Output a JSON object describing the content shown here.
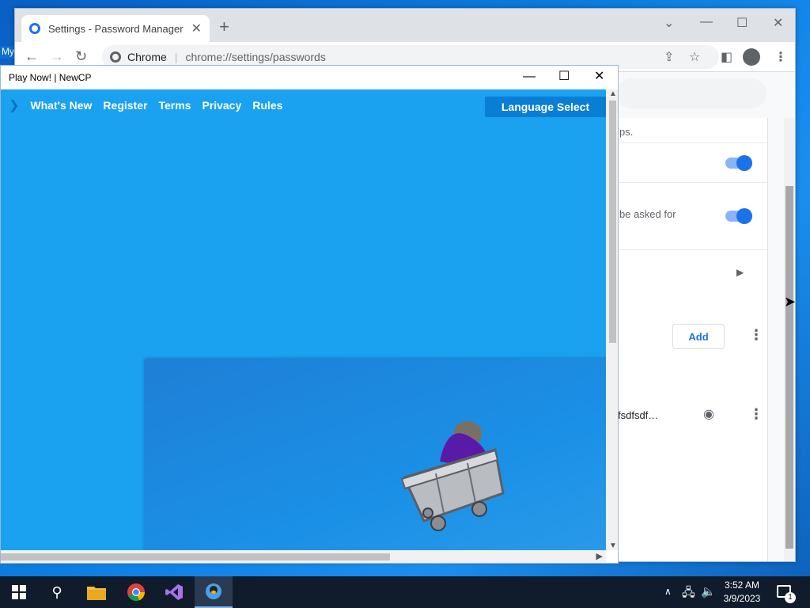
{
  "desktop": {
    "icon_label": "My"
  },
  "chrome": {
    "tab_title": "Settings - Password Manager",
    "tab_close": "✕",
    "new_tab": "+",
    "omnibox_label": "Chrome",
    "url": "chrome://settings/passwords",
    "settings": {
      "row1_text": "ps.",
      "row2_text": "be asked for",
      "add_label": "Add",
      "password_text": "fsdfsdf…",
      "toggle1_on": true,
      "toggle2_on": true
    }
  },
  "newcp": {
    "title": "Play Now! | NewCP",
    "nav": [
      "What's New",
      "Register",
      "Terms",
      "Privacy",
      "Rules"
    ],
    "language_button": "Language Select"
  },
  "taskbar": {
    "time": "3:52 AM",
    "date": "3/9/2023",
    "notification_count": "1"
  },
  "colors": {
    "game_bg": "#1aa1f0",
    "accent": "#1a73e8",
    "taskbar": "#101c2c"
  }
}
